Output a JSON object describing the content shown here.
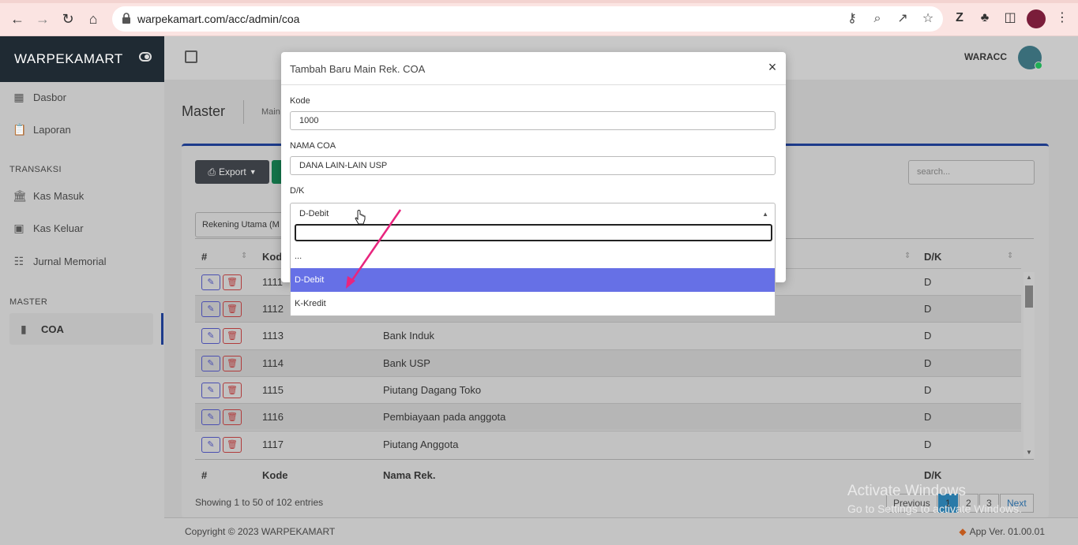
{
  "browser": {
    "url": "warpekamart.com/acc/admin/coa"
  },
  "app": {
    "brand": "WARPEKAMART",
    "user": "WARACC",
    "menu": {
      "dasbor": "Dasbor",
      "laporan": "Laporan",
      "section_transaksi": "TRANSAKSI",
      "kas_masuk": "Kas Masuk",
      "kas_keluar": "Kas Keluar",
      "jurnal_memorial": "Jurnal Memorial",
      "section_master": "MASTER",
      "coa": "COA"
    },
    "page_title": "Master",
    "breadcrumb": "Main",
    "export_label": "Export",
    "search_placeholder": "search...",
    "filter_value": "Rekening Utama (M",
    "table": {
      "headers": {
        "no": "#",
        "kode": "Kode",
        "nama": "Nama Rek.",
        "dk": "D/K"
      },
      "rows": [
        {
          "kode": "1111",
          "nama": "",
          "dk": "D"
        },
        {
          "kode": "1112",
          "nama": "",
          "dk": "D"
        },
        {
          "kode": "1113",
          "nama": "Bank Induk",
          "dk": "D"
        },
        {
          "kode": "1114",
          "nama": "Bank USP",
          "dk": "D"
        },
        {
          "kode": "1115",
          "nama": "Piutang Dagang Toko",
          "dk": "D"
        },
        {
          "kode": "1116",
          "nama": "Pembiayaan pada anggota",
          "dk": "D"
        },
        {
          "kode": "1117",
          "nama": "Piutang Anggota",
          "dk": "D"
        }
      ]
    },
    "info": "Showing 1 to 50 of 102 entries",
    "pagination": {
      "prev": "Previous",
      "p1": "1",
      "p2": "2",
      "p3": "3",
      "next": "Next"
    },
    "footer": {
      "copyright": "Copyright © 2023 WARPEKAMART",
      "version": "App Ver. 01.00.01"
    },
    "watermark": {
      "line1": "Activate Windows",
      "line2": "Go to Settings to activate Windows."
    }
  },
  "modal": {
    "title": "Tambah Baru Main Rek. COA",
    "close": "×",
    "kode_label": "Kode",
    "kode_value": "1000",
    "nama_label": "NAMA COA",
    "nama_value": "DANA LAIN-LAIN USP",
    "dk_label": "D/K",
    "dk_selected": "D-Debit",
    "options": [
      "...",
      "D-Debit",
      "K-Kredit"
    ]
  },
  "colors": {
    "highlight": "#6670e6",
    "arrow": "#e8257e",
    "brand_dark": "#1f2a33"
  }
}
